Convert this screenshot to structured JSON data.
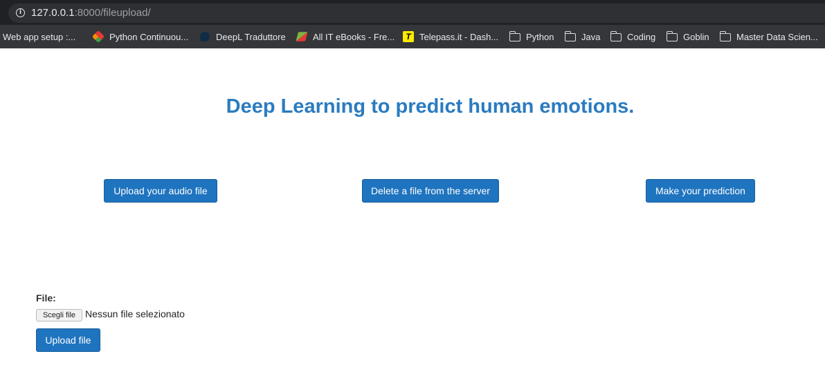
{
  "browser": {
    "url_host": "127.0.0.1",
    "url_rest": ":8000/fileupload/",
    "bookmarks": [
      {
        "label": "Web app setup :...",
        "icon": "none"
      },
      {
        "label": "Python Continuou...",
        "icon": "python-continuous-icon"
      },
      {
        "label": "DeepL Traduttore",
        "icon": "deepl-icon"
      },
      {
        "label": "All IT eBooks - Fre...",
        "icon": "itebooks-icon"
      },
      {
        "label": "Telepass.it - Dash...",
        "icon": "telepass-icon",
        "glyph": "T"
      },
      {
        "label": "Python",
        "icon": "folder-icon"
      },
      {
        "label": "Java",
        "icon": "folder-icon"
      },
      {
        "label": "Coding",
        "icon": "folder-icon"
      },
      {
        "label": "Goblin",
        "icon": "folder-icon"
      },
      {
        "label": "Master Data Scien...",
        "icon": "folder-icon"
      }
    ]
  },
  "page": {
    "title": "Deep Learning to predict human emotions.",
    "actions": {
      "upload_audio": "Upload your audio file",
      "delete_file": "Delete a file from the server",
      "make_prediction": "Make your prediction"
    },
    "form": {
      "file_label": "File:",
      "choose_button": "Scegli file",
      "no_file_text": "Nessun file selezionato",
      "submit": "Upload file"
    }
  },
  "colors": {
    "accent": "#1f74bf",
    "title": "#2a7bc0"
  }
}
